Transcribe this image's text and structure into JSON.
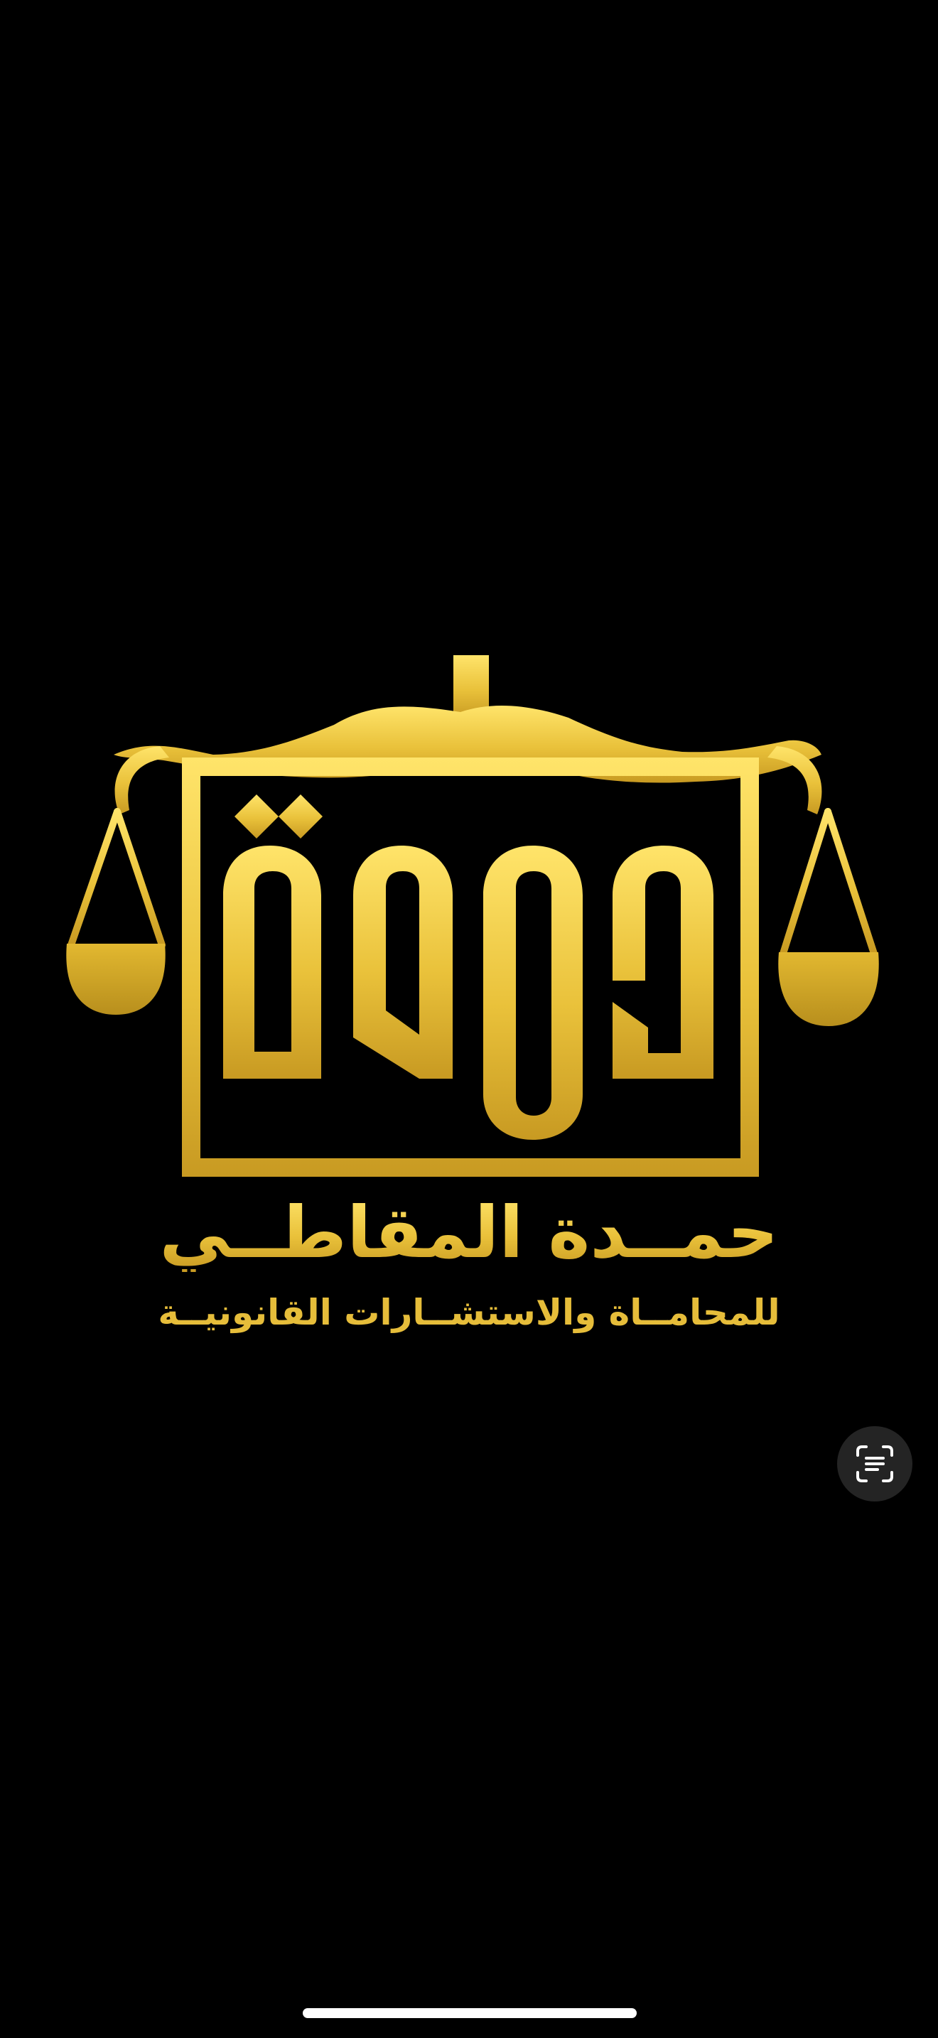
{
  "viewer": {
    "background": "#000000"
  },
  "logo": {
    "emblem": "scales-of-justice-emblem",
    "monogram_text": "حمدة",
    "firm_name": "حمــدة المقاطــي",
    "tagline": "للمحامــاة والاستشــارات القانونيــة",
    "colors": {
      "gold_light": "#ffe46a",
      "gold_mid": "#e9c13a",
      "gold_dark": "#c89a22"
    }
  },
  "live_text_button": {
    "icon": "live-text-scan-icon"
  },
  "home_indicator": {
    "color": "#ffffff"
  }
}
